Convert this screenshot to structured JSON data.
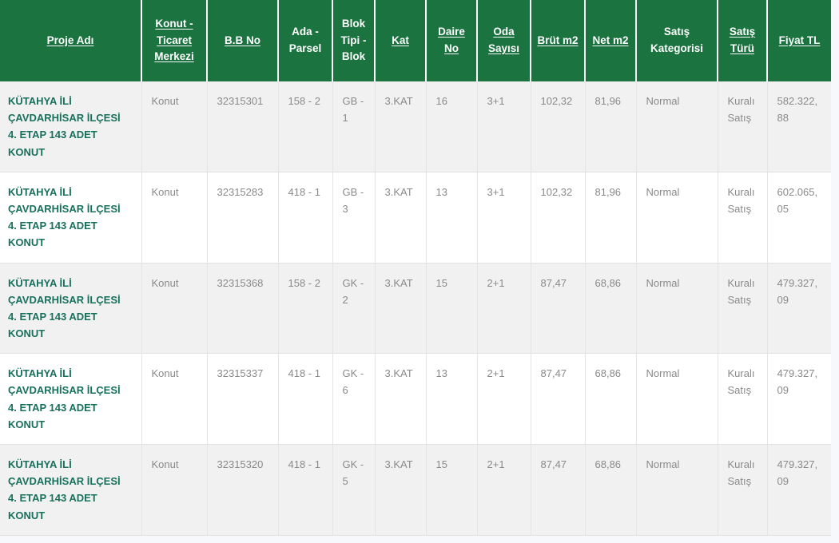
{
  "table": {
    "columns": [
      {
        "label": "Proje Adı",
        "sortable": true,
        "key": "proje_adi"
      },
      {
        "label": "Konut - Ticaret Merkezi",
        "sortable": true,
        "key": "konut_ticaret_merkezi"
      },
      {
        "label": "B.B No",
        "sortable": true,
        "key": "bb_no"
      },
      {
        "label": "Ada - Parsel",
        "sortable": false,
        "key": "ada_parsel"
      },
      {
        "label": "Blok Tipi - Blok",
        "sortable": false,
        "key": "blok_tipi_blok"
      },
      {
        "label": "Kat",
        "sortable": true,
        "key": "kat"
      },
      {
        "label": "Daire No",
        "sortable": true,
        "key": "daire_no"
      },
      {
        "label": "Oda Sayısı",
        "sortable": true,
        "key": "oda_sayisi"
      },
      {
        "label": "Brüt m2",
        "sortable": true,
        "key": "brut_m2"
      },
      {
        "label": "Net m2",
        "sortable": true,
        "key": "net_m2"
      },
      {
        "label": "Satış Kategorisi",
        "sortable": false,
        "key": "satis_kategorisi"
      },
      {
        "label": "Satış Türü",
        "sortable": true,
        "key": "satis_turu"
      },
      {
        "label": "Fiyat TL",
        "sortable": true,
        "key": "fiyat_tl"
      }
    ],
    "rows": [
      {
        "proje_adi": "KÜTAHYA İLİ ÇAVDARHİSAR İLÇESİ 4. ETAP 143 ADET KONUT",
        "konut_ticaret_merkezi": "Konut",
        "bb_no": "32315301",
        "ada_parsel": "158 - 2",
        "blok_tipi_blok": "GB - 1",
        "kat": "3.KAT",
        "daire_no": "16",
        "oda_sayisi": "3+1",
        "brut_m2": "102,32",
        "net_m2": "81,96",
        "satis_kategorisi": "Normal",
        "satis_turu": "Kuralı Satış",
        "fiyat_tl": "582.322,88"
      },
      {
        "proje_adi": "KÜTAHYA İLİ ÇAVDARHİSAR İLÇESİ 4. ETAP 143 ADET KONUT",
        "konut_ticaret_merkezi": "Konut",
        "bb_no": "32315283",
        "ada_parsel": "418 - 1",
        "blok_tipi_blok": "GB - 3",
        "kat": "3.KAT",
        "daire_no": "13",
        "oda_sayisi": "3+1",
        "brut_m2": "102,32",
        "net_m2": "81,96",
        "satis_kategorisi": "Normal",
        "satis_turu": "Kuralı Satış",
        "fiyat_tl": "602.065,05"
      },
      {
        "proje_adi": "KÜTAHYA İLİ ÇAVDARHİSAR İLÇESİ 4. ETAP 143 ADET KONUT",
        "konut_ticaret_merkezi": "Konut",
        "bb_no": "32315368",
        "ada_parsel": "158 - 2",
        "blok_tipi_blok": "GK - 2",
        "kat": "3.KAT",
        "daire_no": "15",
        "oda_sayisi": "2+1",
        "brut_m2": "87,47",
        "net_m2": "68,86",
        "satis_kategorisi": "Normal",
        "satis_turu": "Kuralı Satış",
        "fiyat_tl": "479.327,09"
      },
      {
        "proje_adi": "KÜTAHYA İLİ ÇAVDARHİSAR İLÇESİ 4. ETAP 143 ADET KONUT",
        "konut_ticaret_merkezi": "Konut",
        "bb_no": "32315337",
        "ada_parsel": "418 - 1",
        "blok_tipi_blok": "GK - 6",
        "kat": "3.KAT",
        "daire_no": "13",
        "oda_sayisi": "2+1",
        "brut_m2": "87,47",
        "net_m2": "68,86",
        "satis_kategorisi": "Normal",
        "satis_turu": "Kuralı Satış",
        "fiyat_tl": "479.327,09"
      },
      {
        "proje_adi": "KÜTAHYA İLİ ÇAVDARHİSAR İLÇESİ 4. ETAP 143 ADET KONUT",
        "konut_ticaret_merkezi": "Konut",
        "bb_no": "32315320",
        "ada_parsel": "418 - 1",
        "blok_tipi_blok": "GK - 5",
        "kat": "3.KAT",
        "daire_no": "15",
        "oda_sayisi": "2+1",
        "brut_m2": "87,47",
        "net_m2": "68,86",
        "satis_kategorisi": "Normal",
        "satis_turu": "Kuralı Satış",
        "fiyat_tl": "479.327,09"
      }
    ]
  },
  "colors": {
    "header_bg": "#1b7340",
    "header_text": "#ffffff",
    "project_text": "#17715c",
    "cell_text": "#8a8a8a",
    "row_alt_bg": "#f1f1f1",
    "row_bg": "#ffffff",
    "page_bg": "#f7f8fb"
  }
}
